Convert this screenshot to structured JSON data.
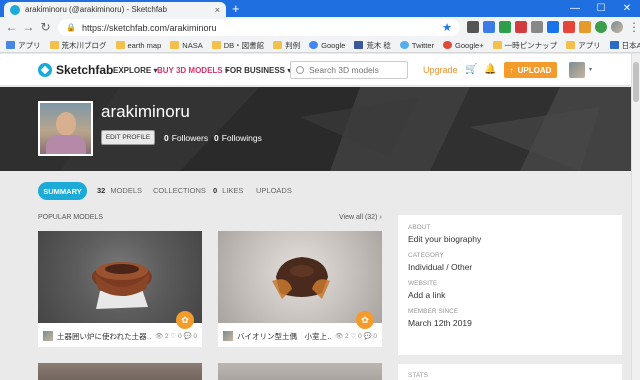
{
  "browser": {
    "tab_title": "arakiminoru (@arakiminoru) - Sketchfab",
    "close": "×",
    "new_tab": "+",
    "url": "https://sketchfab.com/arakiminoru",
    "window": {
      "minimize": "—",
      "maximize": "☐",
      "close": "✕"
    }
  },
  "bookmarks": [
    {
      "label": "アプリ"
    },
    {
      "label": "荒木川ブログ"
    },
    {
      "label": "earth map"
    },
    {
      "label": "NASA"
    },
    {
      "label": "DB・図書館"
    },
    {
      "label": "判例"
    },
    {
      "label": "Google"
    },
    {
      "label": "荒木 稔"
    },
    {
      "label": "Twitter"
    },
    {
      "label": "Google+"
    },
    {
      "label": "一時ピンナップ"
    },
    {
      "label": "アプリ"
    },
    {
      "label": "日本Amazon Drive"
    }
  ],
  "header": {
    "logo": "Sketchfab",
    "nav": {
      "explore": "EXPLORE ▾",
      "buy": "BUY 3D MODELS ▾",
      "business": "FOR BUSINESS ▾"
    },
    "search_placeholder": "Search 3D models",
    "upgrade": "Upgrade",
    "upload": "UPLOAD",
    "upload_arrow": "↑",
    "caret": "▾"
  },
  "profile": {
    "username": "arakiminoru",
    "edit_profile": "EDIT PROFILE",
    "followers_count": "0",
    "followers_label": "Followers",
    "followings_count": "0",
    "followings_label": "Followings"
  },
  "tabs": {
    "summary": "SUMMARY",
    "models_count": "32",
    "models": "MODELS",
    "collections": "COLLECTIONS",
    "likes_count": "0",
    "likes": "LIKES",
    "uploads": "UPLOADS"
  },
  "popular": {
    "title": "POPULAR MODELS",
    "view_all": "View all (32) ›",
    "cards": [
      {
        "name": "土器囲い炉に使われた土器…",
        "stats": "👁 2  ♡ 0  💬 0",
        "badge": "✿"
      },
      {
        "name": "バイオリン型土偶　小室上…",
        "stats": "👁 2  ♡ 0  💬 0",
        "badge": "✿"
      }
    ]
  },
  "sidebar": {
    "about_label": "ABOUT",
    "about_value": "Edit your biography",
    "category_label": "CATEGORY",
    "category_value": "Individual / Other",
    "website_label": "WEBSITE",
    "website_value": "Add a link",
    "member_label": "MEMBER SINCE",
    "member_value": "March 12th 2019",
    "stats_label": "STATS"
  }
}
